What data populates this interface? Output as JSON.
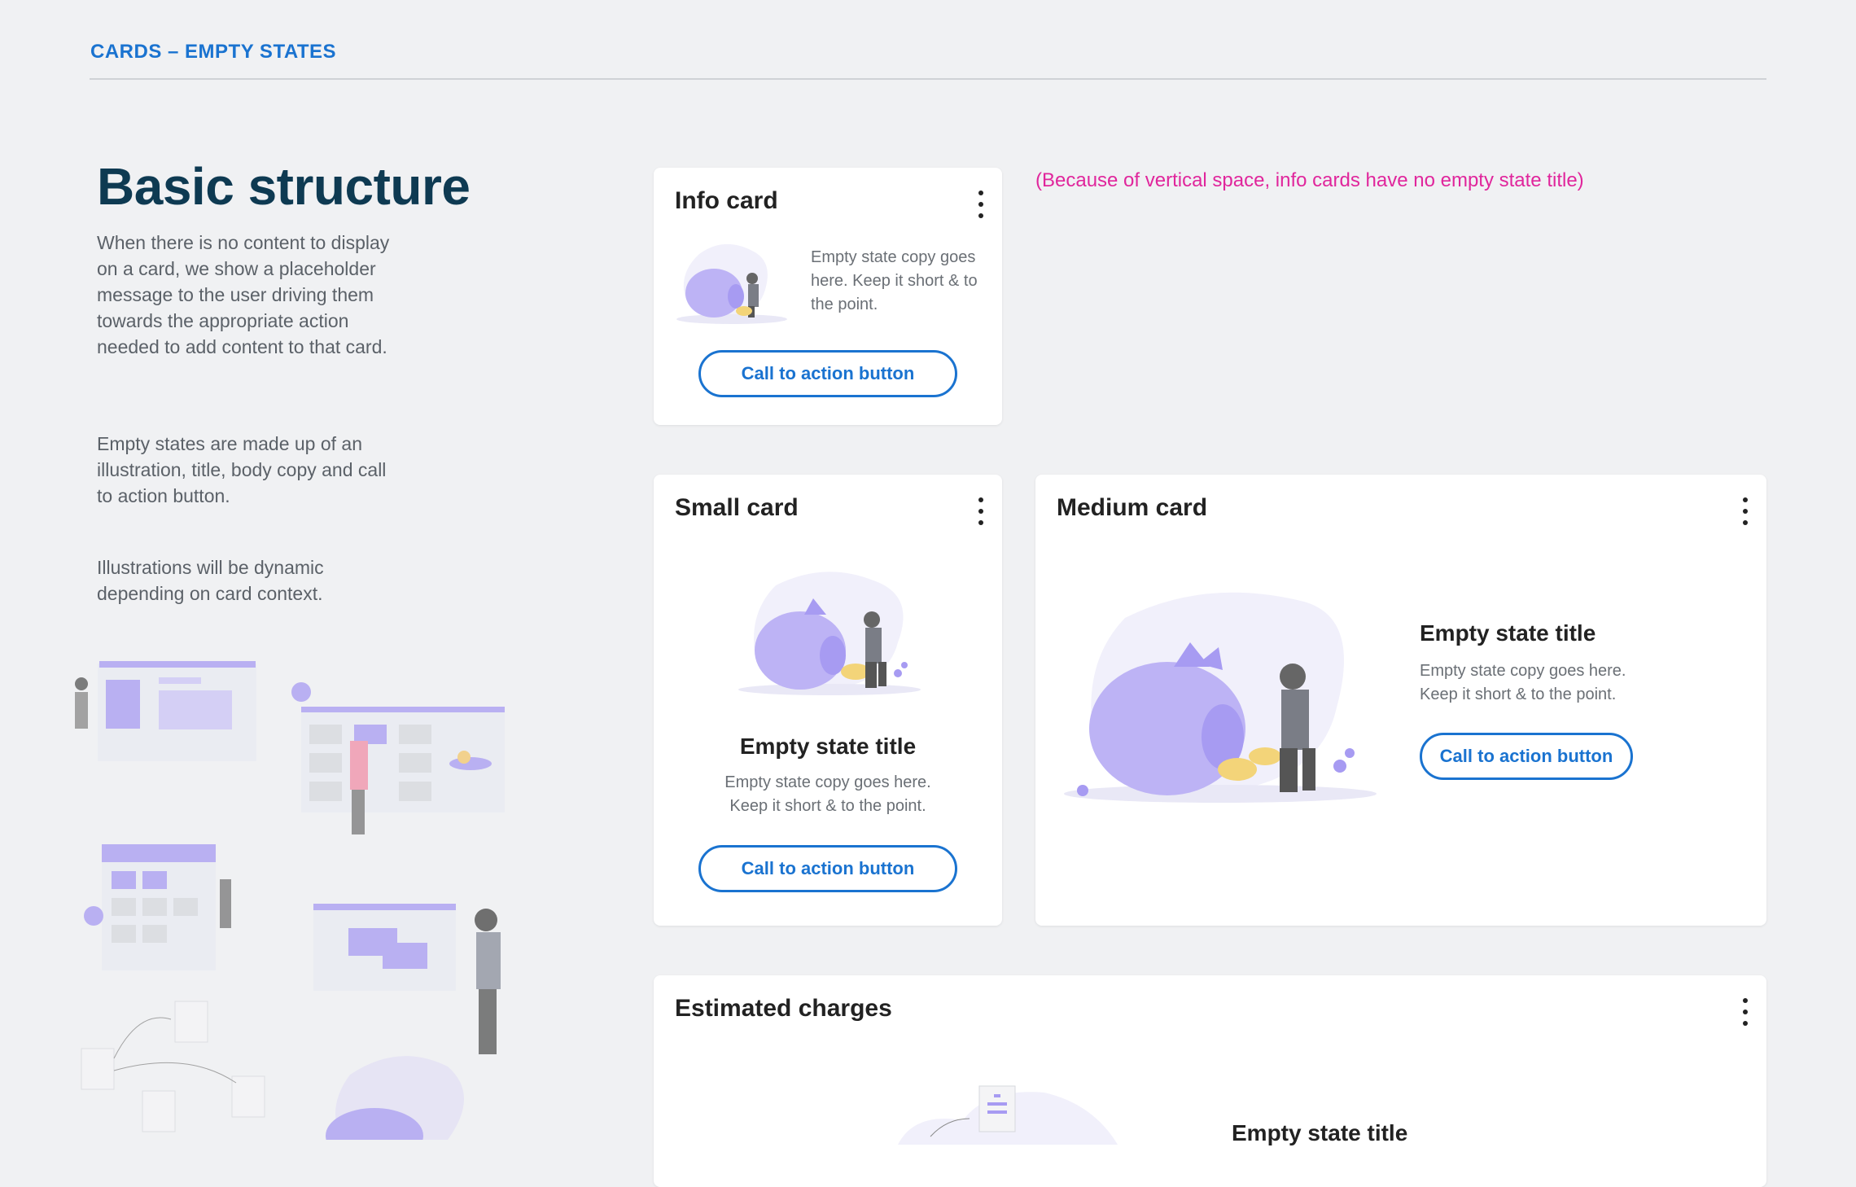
{
  "header": {
    "title": "CARDS – EMPTY STATES"
  },
  "intro": {
    "title": "Basic structure",
    "paragraphs": [
      "When there is no content to display on a card, we show a placeholder message to the user driving them towards the appropriate action needed to add content to that card.",
      "Empty states are made up of an illustration, title, body copy and call to action button.",
      "Illustrations will be dynamic depending on card context."
    ]
  },
  "note": "(Because of vertical space, info cards have no empty state title)",
  "info_card": {
    "title": "Info card",
    "copy": "Empty state copy goes here. Keep it short & to the point.",
    "cta": "Call to action button"
  },
  "small_card": {
    "title": "Small card",
    "empty_title": "Empty state title",
    "copy": "Empty state copy goes here. Keep it short & to the point.",
    "cta": "Call to action button"
  },
  "medium_card": {
    "title": "Medium card",
    "empty_title": "Empty state title",
    "copy": "Empty state copy goes here. Keep it short & to the point.",
    "cta": "Call to action button"
  },
  "charges_card": {
    "title": "Estimated charges",
    "empty_title": "Empty state title"
  },
  "icons": [
    "kebab-menu-icon",
    "piggy-bank-illustration",
    "empty-states-illustration-collage"
  ],
  "colors": {
    "accent": "#1a73d0",
    "heading": "#0e3a52",
    "note": "#e0269c",
    "illustration": "#a79bf2"
  }
}
